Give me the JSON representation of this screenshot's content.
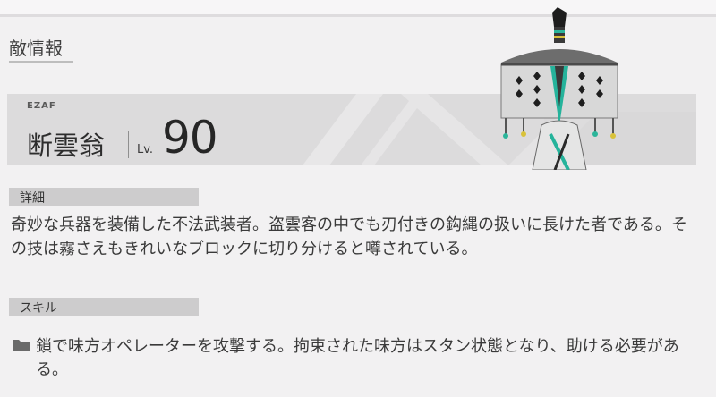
{
  "page": {
    "title": "敵情報"
  },
  "enemy": {
    "tag": "EZAF",
    "name": "断雲翁",
    "level_label": "Lv.",
    "level": "90"
  },
  "details": {
    "header": "詳細",
    "text": "奇妙な兵器を装備した不法武装者。盗雲客の中でも刃付きの鈎縄の扱いに長けた者である。その技は霧さえもきれいなブロックに切り分けると噂されている。"
  },
  "skills": {
    "header": "スキル",
    "items": [
      {
        "icon": "folder-icon",
        "text": "鎖で味方オペレーターを攻撃する。拘束された味方はスタン状態となり、助ける必要がある。"
      }
    ]
  }
}
